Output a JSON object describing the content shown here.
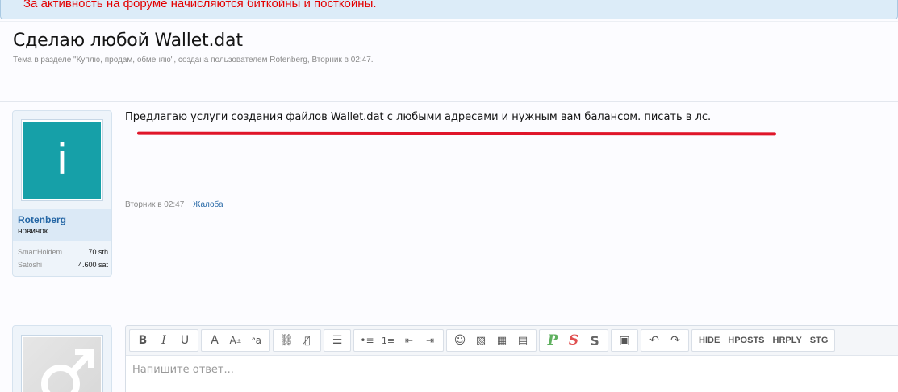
{
  "notice": "За активность на форуме начисляются биткойны и посткойны.",
  "thread": {
    "title": "Сделаю любой Wallet.dat",
    "subtitle": "Тема в разделе \"Куплю, продам, обменяю\", создана пользователем Rotenberg, Вторник в 02:47."
  },
  "post": {
    "avatar_letter": "i",
    "username": "Rotenberg",
    "rank": "новичок",
    "stats": [
      {
        "label": "SmartHoldem",
        "value": "70 sth"
      },
      {
        "label": "Satoshi",
        "value": "4.600 sat"
      }
    ],
    "text": "Предлагаю услуги создания файлов Wallet.dat с любыми адресами и нужным вам балансом. писать в лс.",
    "date": "Вторник в 02:47",
    "report_label": "Жалоба"
  },
  "editor": {
    "placeholder": "Напишите ответ...",
    "toolbar_text_buttons": [
      "HIDE",
      "HPOSTS",
      "HRPLY",
      "STG"
    ]
  },
  "colors": {
    "accent_link": "#2466a5",
    "notice_text": "#e30000",
    "avatar_bg": "#16a0a8",
    "highlight_line": "#e0162a"
  }
}
